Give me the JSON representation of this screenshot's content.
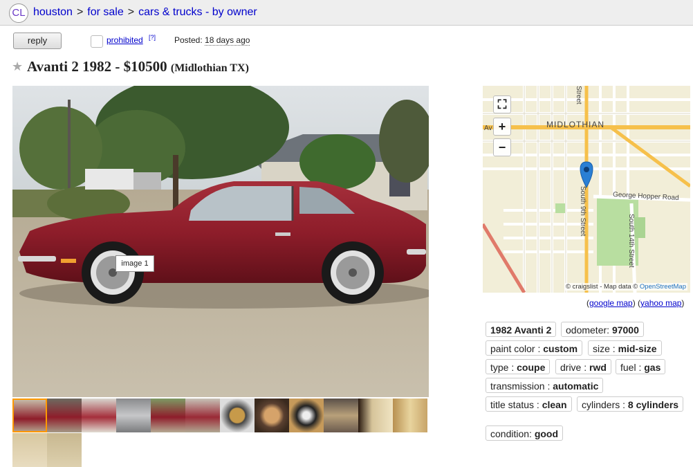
{
  "logo": "CL",
  "breadcrumb": [
    "houston",
    "for sale",
    "cars & trucks - by owner"
  ],
  "breadcrumb_sep": ">",
  "reply_label": "reply",
  "prohibited_label": "prohibited",
  "prohibited_sup": "[?]",
  "posted_label": "Posted:",
  "posted_value": "18 days ago",
  "title": {
    "name": "Avanti 2 1982",
    "dash": "-",
    "price": "$10500",
    "location": "(Midlothian TX)"
  },
  "image_label": "image 1",
  "thumbnail_count": 13,
  "map": {
    "place_label": "MIDLOTHIAN",
    "road1": "George Hopper Road",
    "road2": "South 9th Street",
    "road3": "South 14th Street",
    "road4": "Street",
    "road5": "Av",
    "credit_prefix": "© craigslist - Map data ©",
    "credit_link": "OpenStreetMap"
  },
  "map_links": {
    "open": "(",
    "google": "google map",
    "mid": ") (",
    "yahoo": "yahoo map",
    "close": ")"
  },
  "attributes": {
    "model": "1982 Avanti 2",
    "odometer_k": "odometer:",
    "odometer_v": "97000",
    "paint_k": "paint color :",
    "paint_v": "custom",
    "size_k": "size :",
    "size_v": "mid-size",
    "type_k": "type :",
    "type_v": "coupe",
    "drive_k": "drive :",
    "drive_v": "rwd",
    "fuel_k": "fuel :",
    "fuel_v": "gas",
    "trans_k": "transmission :",
    "trans_v": "automatic",
    "title_k": "title status :",
    "title_v": "clean",
    "cyl_k": "cylinders :",
    "cyl_v": "8 cylinders",
    "cond_k": "condition:",
    "cond_v": "good"
  },
  "colors": {
    "link": "#0000cc",
    "car_red": "#8e1d2a",
    "map_road": "#f6c04b",
    "marker": "#2a7fd4"
  }
}
